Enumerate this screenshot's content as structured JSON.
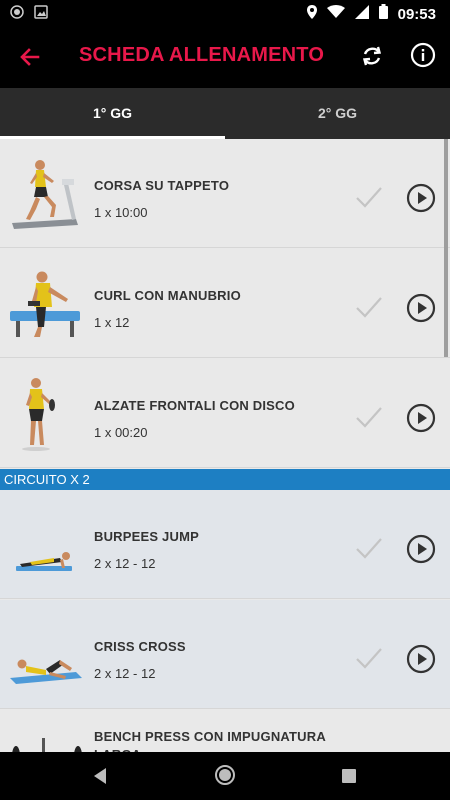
{
  "status_bar": {
    "time": "09:53"
  },
  "app_bar": {
    "title": "SCHEDA ALLENAMENTO",
    "accent_color": "#e8184a"
  },
  "tabs": [
    {
      "label": "1° GG",
      "active": true
    },
    {
      "label": "2° GG",
      "active": false
    }
  ],
  "exercises": [
    {
      "name": "CORSA SU TAPPETO",
      "sets": "1 x 10:00",
      "icon": "treadmill-illustration"
    },
    {
      "name": "CURL CON MANUBRIO",
      "sets": "1 x 12",
      "icon": "dumbbell-curl-illustration"
    },
    {
      "name": "ALZATE FRONTALI CON DISCO",
      "sets": "1 x 00:20",
      "icon": "plate-front-raise-illustration"
    }
  ],
  "circuit": {
    "label": "CIRCUITO X 2",
    "color": "#1d7fc3",
    "exercises": [
      {
        "name": "BURPEES JUMP",
        "sets": "2 x 12 - 12",
        "icon": "burpee-illustration"
      },
      {
        "name": "CRISS CROSS",
        "sets": "2 x 12 - 12",
        "icon": "criss-cross-illustration"
      },
      {
        "name": "BENCH PRESS CON IMPUGNATURA LARGA",
        "sets": "",
        "icon": "bench-press-illustration"
      }
    ]
  }
}
